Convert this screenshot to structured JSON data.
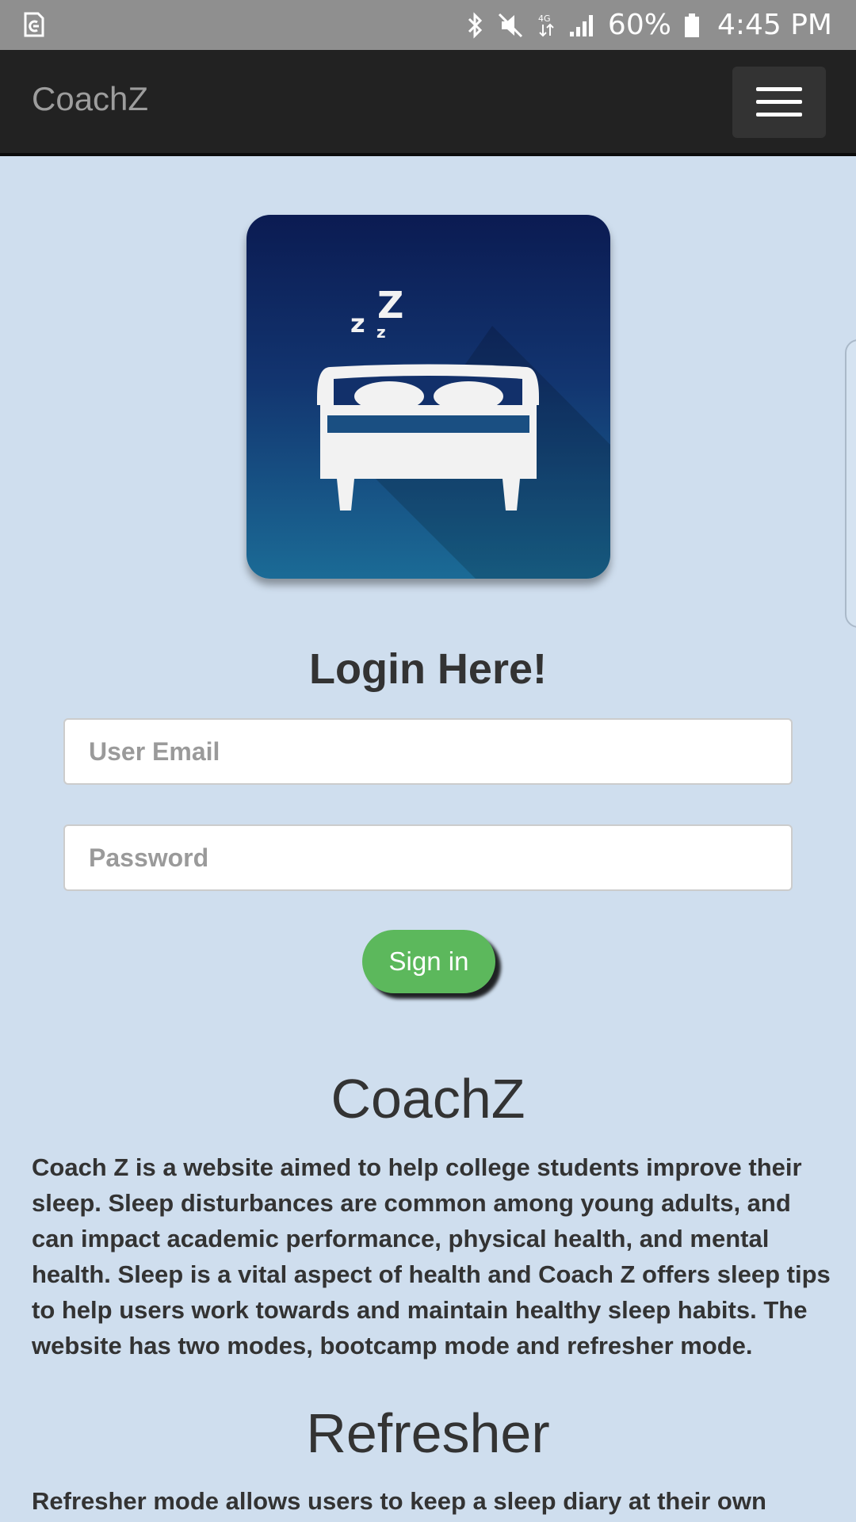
{
  "status_bar": {
    "battery": "60%",
    "time": "4:45 PM",
    "network": "4G",
    "icons": [
      "app-notification-icon",
      "bluetooth-icon",
      "mute-icon",
      "data-icon",
      "signal-icon",
      "battery-icon"
    ]
  },
  "navbar": {
    "brand": "CoachZ",
    "menu_icon": "hamburger-menu-icon"
  },
  "logo": {
    "icon": "sleeping-bed-icon",
    "zzz": [
      "z",
      "z",
      "Z"
    ]
  },
  "login": {
    "title": "Login Here!",
    "email_placeholder": "User Email",
    "email_value": "",
    "password_placeholder": "Password",
    "password_value": "",
    "signin_label": "Sign in"
  },
  "about": {
    "heading": "CoachZ",
    "text": "Coach Z is a website aimed to help college students improve their sleep. Sleep disturbances are common among young adults, and can impact academic performance, physical health, and mental health. Sleep is a vital aspect of health and Coach Z offers sleep tips to help users work towards and maintain healthy sleep habits. The website has two modes, bootcamp mode and refresher mode."
  },
  "refresher": {
    "heading": "Refresher",
    "text": "Refresher mode allows users to keep a sleep diary at their own"
  },
  "colors": {
    "page_background": "#cfdeee",
    "navbar": "#222222",
    "status_bar": "#8f8f8f",
    "signin_button": "#5cb85c",
    "logo_top": "#0b1b52",
    "logo_bottom": "#1b6b96"
  }
}
